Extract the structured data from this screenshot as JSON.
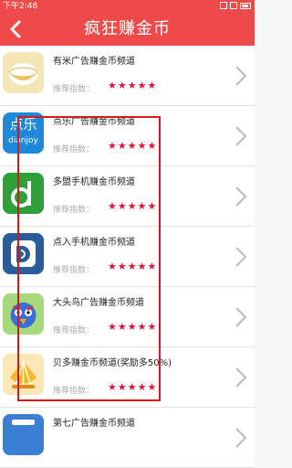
{
  "status_bar": {
    "time": "下午2:48"
  },
  "header": {
    "back_label": "<",
    "title": "疯狂赚金币"
  },
  "recommend_label": "推荐指数：",
  "stars": "★★★★★",
  "apps": [
    {
      "name": "有米广告赚金币频道",
      "icon": "youmi-bowl-icon"
    },
    {
      "name": "点乐广告赚金币频道",
      "icon": "dianjoy-icon",
      "icon_text_top": "点乐",
      "icon_text_bottom": "dianjoy"
    },
    {
      "name": "多盟手机赚金币频道",
      "icon": "domob-d-icon"
    },
    {
      "name": "点入手机赚金币频道",
      "icon": "dianru-icon"
    },
    {
      "name": "大头鸟广告赚金币频道",
      "icon": "bird-icon"
    },
    {
      "name": "贝多赚金币频道(奖励多50%)",
      "icon": "beiduo-shell-icon"
    },
    {
      "name": "第七广告赚金币频道",
      "icon": "diqi-icon"
    }
  ],
  "colors": {
    "header": "#ef4a4a",
    "stars": "#d9163a",
    "highlight_box": "#d21a1a"
  }
}
